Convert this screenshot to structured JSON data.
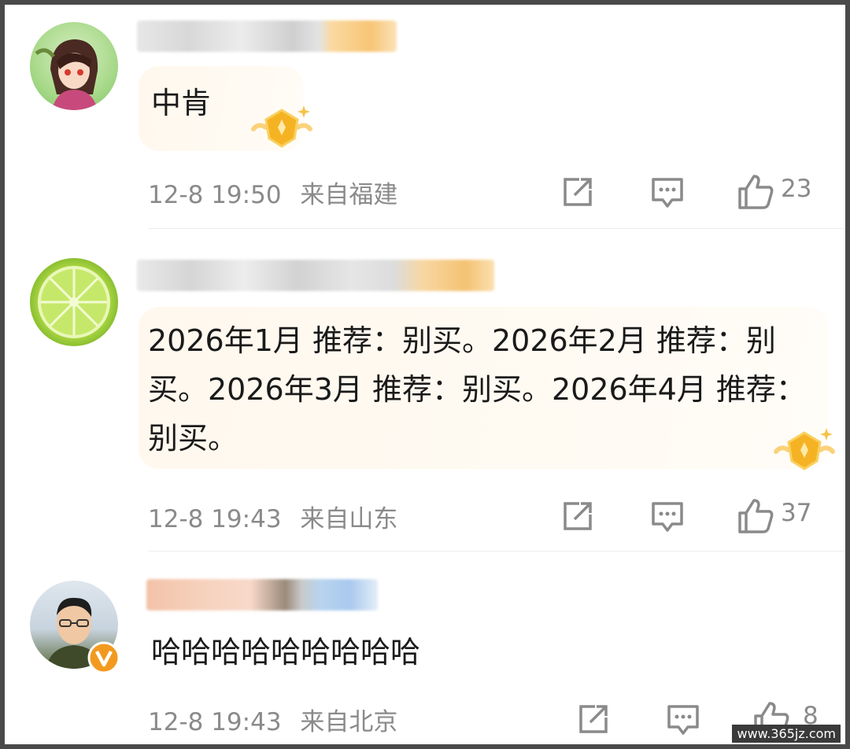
{
  "comments": [
    {
      "text": "中肯",
      "time": "12-8 19:50",
      "location": "来自福建",
      "likes": "23"
    },
    {
      "text": "2026年1月 推荐：别买。2026年2月 推荐：别买。2026年3月 推荐：别买。2026年4月 推荐：别买。",
      "time": "12-8 19:43",
      "location": "来自山东",
      "likes": "37"
    },
    {
      "text": "哈哈哈哈哈哈哈哈哈",
      "time": "12-8 19:43",
      "location": "来自北京",
      "likes": "8"
    }
  ],
  "icons": {
    "share": "share-icon",
    "reply": "reply-icon",
    "like": "thumbs-up-icon",
    "badge": "gold-badge-icon",
    "verified": "verified-v-icon"
  },
  "watermark": "www.365jz.com",
  "colors": {
    "meta_text": "#8a8a8a",
    "bubble_bg": "#fff8ee",
    "badge_gold": "#f5b324",
    "verified_orange": "#f29a1f"
  }
}
